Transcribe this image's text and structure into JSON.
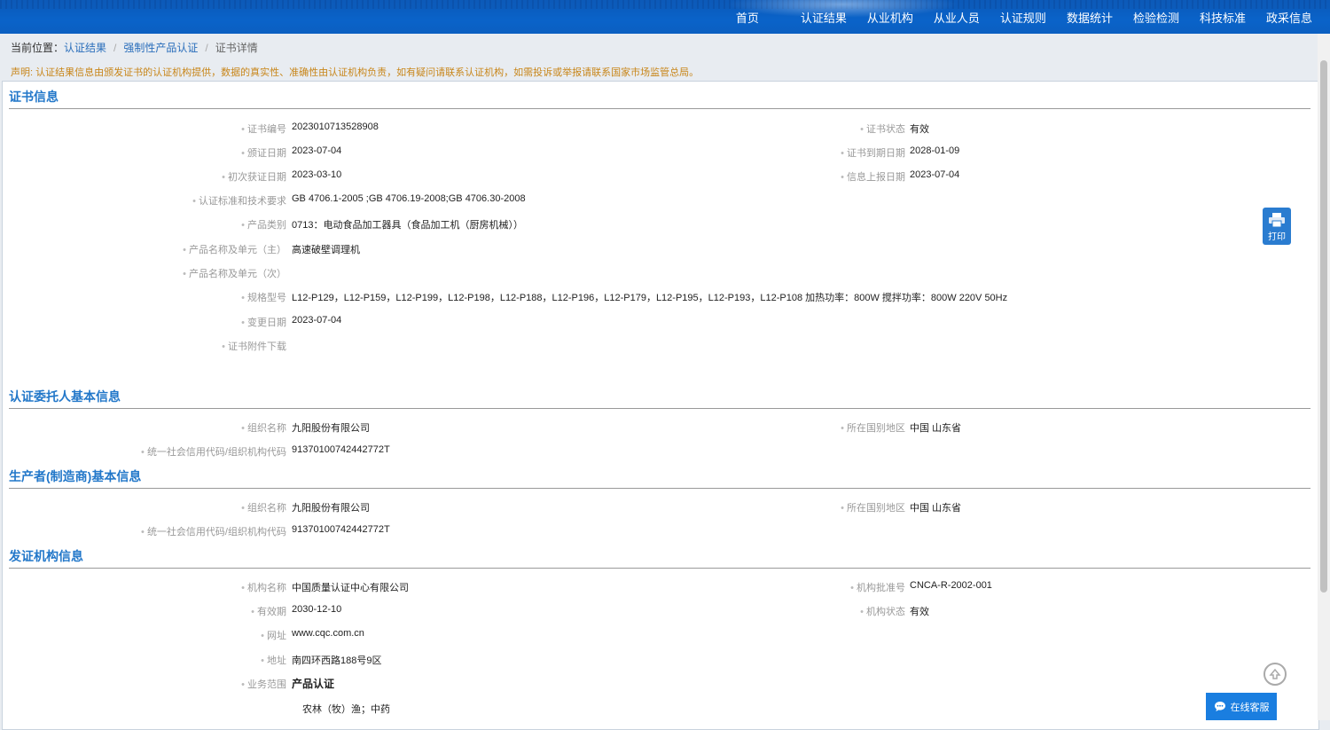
{
  "nav": {
    "items": [
      "首页",
      "认证结果",
      "从业机构",
      "从业人员",
      "认证规则",
      "数据统计",
      "检验检测",
      "科技标准",
      "政采信息"
    ]
  },
  "breadcrumb": {
    "prefix": "当前位置：",
    "items": [
      "认证结果",
      "强制性产品认证",
      "证书详情"
    ]
  },
  "notice": "声明: 认证结果信息由颁发证书的认证机构提供，数据的真实性、准确性由认证机构负责，如有疑问请联系认证机构，如需投诉或举报请联系国家市场监管总局。",
  "cert": {
    "title": "证书信息",
    "number_label": "证书编号",
    "number": "2023010713528908",
    "status_label": "证书状态",
    "status": "有效",
    "issue_date_label": "颁证日期",
    "issue_date": "2023-07-04",
    "expire_date_label": "证书到期日期",
    "expire_date": "2028-01-09",
    "first_date_label": "初次获证日期",
    "first_date": "2023-03-10",
    "report_date_label": "信息上报日期",
    "report_date": "2023-07-04",
    "standard_label": "认证标准和技术要求",
    "standard": "GB 4706.1-2005 ;GB 4706.19-2008;GB 4706.30-2008",
    "category_label": "产品类别",
    "category": "0713：电动食品加工器具（食品加工机（厨房机械））",
    "product_main_label": "产品名称及单元（主）",
    "product_main": "高速破壁调理机",
    "product_sub_label": "产品名称及单元（次）",
    "product_sub": "",
    "model_label": "规格型号",
    "model": "L12-P129，L12-P159，L12-P199，L12-P198，L12-P188，L12-P196，L12-P179，L12-P195，L12-P193，L12-P108 加热功率：800W 搅拌功率：800W 220V 50Hz",
    "change_date_label": "变更日期",
    "change_date": "2023-07-04",
    "attachment_label": "证书附件下载"
  },
  "client": {
    "title": "认证委托人基本信息",
    "org_label": "组织名称",
    "org": "九阳股份有限公司",
    "region_label": "所在国别地区",
    "region": "中国 山东省",
    "code_label": "统一社会信用代码/组织机构代码",
    "code": "91370100742442772T"
  },
  "maker": {
    "title": "生产者(制造商)基本信息",
    "org_label": "组织名称",
    "org": "九阳股份有限公司",
    "region_label": "所在国别地区",
    "region": "中国 山东省",
    "code_label": "统一社会信用代码/组织机构代码",
    "code": "91370100742442772T"
  },
  "issuer": {
    "title": "发证机构信息",
    "name_label": "机构名称",
    "name": "中国质量认证中心有限公司",
    "approval_label": "机构批准号",
    "approval": "CNCA-R-2002-001",
    "valid_label": "有效期",
    "valid": "2030-12-10",
    "state_label": "机构状态",
    "state": "有效",
    "site_label": "网址",
    "site": "www.cqc.com.cn",
    "addr_label": "地址",
    "addr": "南四环西路188号9区",
    "scope_label": "业务范围",
    "scope": "产品认证",
    "scope_sub": "农林（牧）渔；中药"
  },
  "print": {
    "label": "打印",
    "icon": "printer-icon"
  },
  "chat": {
    "label": "在线客服",
    "icon": "chat-bubble-icon"
  },
  "totop": {
    "icon": "back-to-top-icon"
  }
}
